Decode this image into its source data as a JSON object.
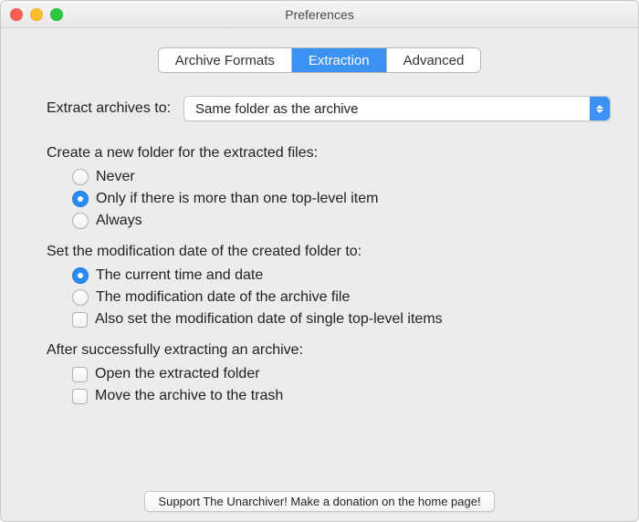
{
  "window": {
    "title": "Preferences"
  },
  "tabs": {
    "archive_formats": "Archive Formats",
    "extraction": "Extraction",
    "advanced": "Advanced",
    "selected": "extraction"
  },
  "extract_to": {
    "label": "Extract archives to:",
    "value": "Same folder as the archive"
  },
  "create_folder": {
    "heading": "Create a new folder for the extracted files:",
    "options": {
      "never": "Never",
      "only_if": "Only if there is more than one top-level item",
      "always": "Always"
    },
    "selected": "only_if"
  },
  "mod_date": {
    "heading": "Set the modification date of the created folder to:",
    "options": {
      "current": "The current time and date",
      "archive": "The modification date of the archive file"
    },
    "selected": "current",
    "also_set": {
      "label": "Also set the modification date of single top-level items",
      "checked": false
    }
  },
  "after_extract": {
    "heading": "After successfully extracting an archive:",
    "open_folder": {
      "label": "Open the extracted folder",
      "checked": false
    },
    "move_trash": {
      "label": "Move the archive to the trash",
      "checked": false
    }
  },
  "footer": {
    "support_button": "Support The Unarchiver! Make a donation on the home page!"
  }
}
